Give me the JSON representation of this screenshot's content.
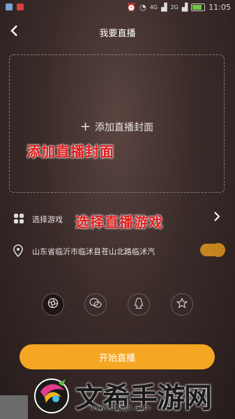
{
  "status_bar": {
    "network_badge_1": "4G",
    "network_badge_2": "2G",
    "time": "11:05"
  },
  "header": {
    "title": "我要直播"
  },
  "cover": {
    "add_label": "添加直播封面"
  },
  "annotations": {
    "cover_note": "添加直播封面",
    "game_note": "选择直播游戏"
  },
  "game_row": {
    "label": "选择游戏"
  },
  "location_row": {
    "address": "山东省临沂市临沭县苍山北路临沭汽",
    "toggle_on": true
  },
  "share": {
    "items": [
      "camera-share",
      "wechat-share",
      "qq-share",
      "star-share"
    ]
  },
  "start_button": {
    "label": "开始直播"
  },
  "watermark": {
    "text": "文希手游网",
    "url": "www.dtygjt.com"
  },
  "colors": {
    "accent": "#f5a623",
    "annotation": "#e41b1b"
  }
}
